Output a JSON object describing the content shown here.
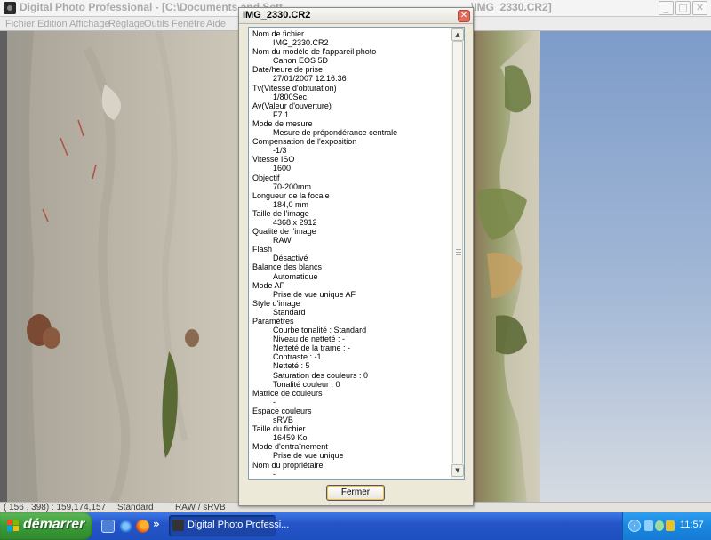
{
  "main_window": {
    "title": "Digital Photo Professional - [C:\\Documents and Sett",
    "title_right": "\\IMG_2330.CR2]",
    "menu": [
      "Fichier",
      "Edition",
      "Affichage",
      "Réglage",
      "Outils",
      "Fenêtre",
      "Aide"
    ],
    "status": {
      "coords": "( 156 , 398) : 159,174,157",
      "picture_style": "Standard",
      "format": "RAW / sRVB"
    }
  },
  "dialog": {
    "title": "IMG_2330.CR2",
    "close_label": "Fermer",
    "fields": [
      {
        "label": "Nom de fichier",
        "value": "IMG_2330.CR2"
      },
      {
        "label": "Nom du modèle de l'appareil photo",
        "value": "Canon EOS 5D"
      },
      {
        "label": "Date/heure de prise",
        "value": "27/01/2007 12:16:36"
      },
      {
        "label": "Tv(Vitesse d'obturation)",
        "value": "1/800Sec."
      },
      {
        "label": "Av(Valeur d'ouverture)",
        "value": "F7.1"
      },
      {
        "label": "Mode de mesure",
        "value": "Mesure de prépondérance centrale"
      },
      {
        "label": "Compensation de l'exposition",
        "value": "-1/3"
      },
      {
        "label": "Vitesse ISO",
        "value": "1600"
      },
      {
        "label": "Objectif",
        "value": "70-200mm"
      },
      {
        "label": "Longueur de la focale",
        "value": "184,0 mm"
      },
      {
        "label": "Taille de l'image",
        "value": "4368 x 2912"
      },
      {
        "label": "Qualité de l'image",
        "value": "RAW"
      },
      {
        "label": "Flash",
        "value": "Désactivé"
      },
      {
        "label": "Balance des blancs",
        "value": "Automatique"
      },
      {
        "label": "Mode AF",
        "value": "Prise de vue unique AF"
      },
      {
        "label": "Style d'image",
        "value": "Standard"
      },
      {
        "label": "Paramètres",
        "values": [
          "Courbe tonalité :    Standard",
          "Niveau de netteté :    -",
          "Netteté de la trame :    -",
          "Contraste :    -1",
          "Netteté :    5",
          "Saturation des couleurs :    0",
          "Tonalité couleur :    0"
        ]
      },
      {
        "label": "Matrice de couleurs",
        "value": "-"
      },
      {
        "label": "Espace couleurs",
        "value": "sRVB"
      },
      {
        "label": "Taille du fichier",
        "value": "16459 Ko"
      },
      {
        "label": "Mode d'entraînement",
        "value": "Prise de vue unique"
      },
      {
        "label": "Nom du propriétaire",
        "value": "-"
      }
    ]
  },
  "taskbar": {
    "start_label": "démarrer",
    "task_label": "Digital Photo Professi...",
    "clock": "11:57"
  }
}
